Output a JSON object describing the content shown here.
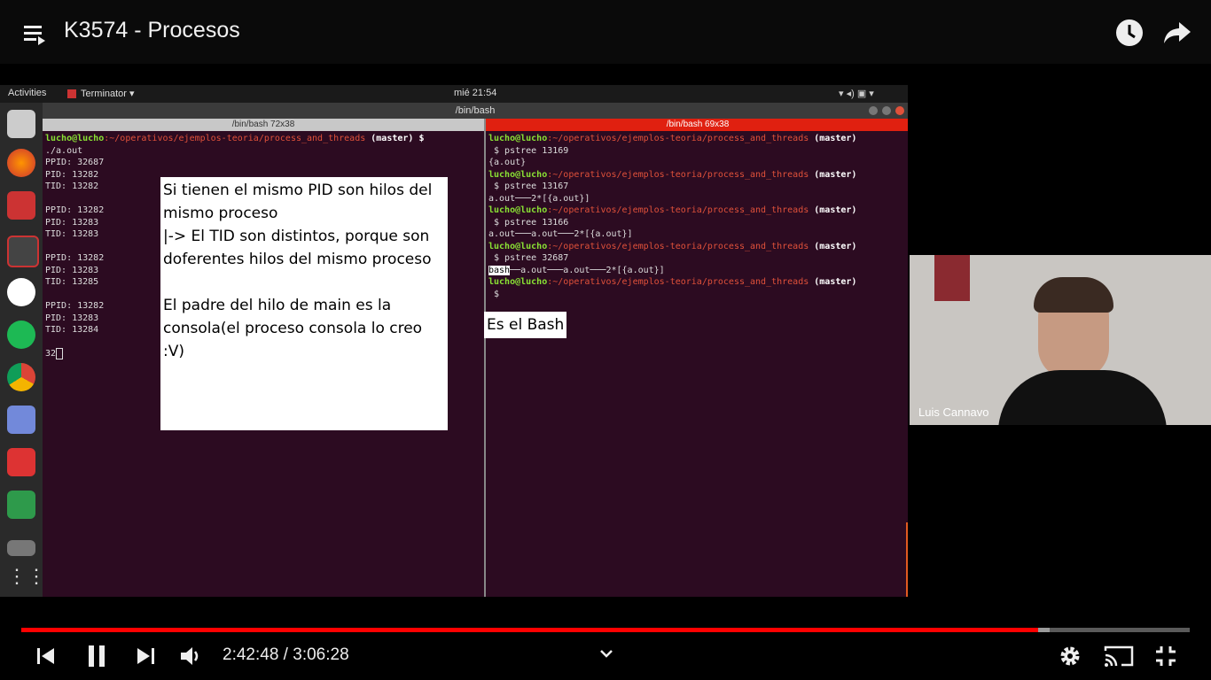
{
  "header": {
    "title": "K3574 - Procesos",
    "icons": [
      "playlist-icon",
      "watch-later-icon",
      "share-icon"
    ]
  },
  "video": {
    "gnome": {
      "activities": "Activities",
      "app": "Terminator ▾",
      "clock": "mié 21:54"
    },
    "window_title": "/bin/bash",
    "left_pane": {
      "header": "/bin/bash 72x38",
      "prompt_user": "lucho@lucho",
      "prompt_path": ":~/operativos/ejemplos-teoria/process_and_threads",
      "prompt_branch": " (master) $",
      "lines": [
        "./a.out",
        "PPID: 32687",
        "PID: 13282",
        "TID: 13282",
        "",
        "PPID: 13282",
        "PID: 13283",
        "TID: 13283",
        "",
        "PPID: 13282",
        "PID: 13283",
        "TID: 13285",
        "",
        "PPID: 13282",
        "PID: 13283",
        "TID: 13284",
        "",
        "32"
      ]
    },
    "right_pane": {
      "header": "/bin/bash 69x38",
      "prompt_user": "lucho@lucho",
      "prompt_path": ":~/operativos/ejemplos-teoria/process_and_threads",
      "prompt_branch": " (master)",
      "blocks": [
        {
          "cmd": " $ pstree 13169",
          "out": "{a.out}"
        },
        {
          "cmd": " $ pstree 13167",
          "out": "a.out───2*[{a.out}]"
        },
        {
          "cmd": " $ pstree 13166",
          "out": "a.out───a.out───2*[{a.out}]"
        },
        {
          "cmd": " $ pstree 32687",
          "out_hl": "bash",
          "out": "──a.out───a.out───2*[{a.out}]"
        }
      ],
      "final_cmd": " $"
    },
    "note_left": [
      "Si tienen el mismo PID son hilos del",
      "mismo proceso",
      "|-> El TID son distintos, porque son",
      "doferentes hilos del mismo proceso",
      "",
      "El padre del hilo de main es la",
      "consola(el proceso consola lo creo :V)"
    ],
    "note_right": "Es el Bash"
  },
  "webcam": {
    "name": "Luis Cannavo"
  },
  "player": {
    "time_current": "2:42:48",
    "time_sep": " / ",
    "time_total": "3:06:28",
    "progress": 0.87,
    "buffered": 0.88,
    "accent": "#ff0000"
  }
}
